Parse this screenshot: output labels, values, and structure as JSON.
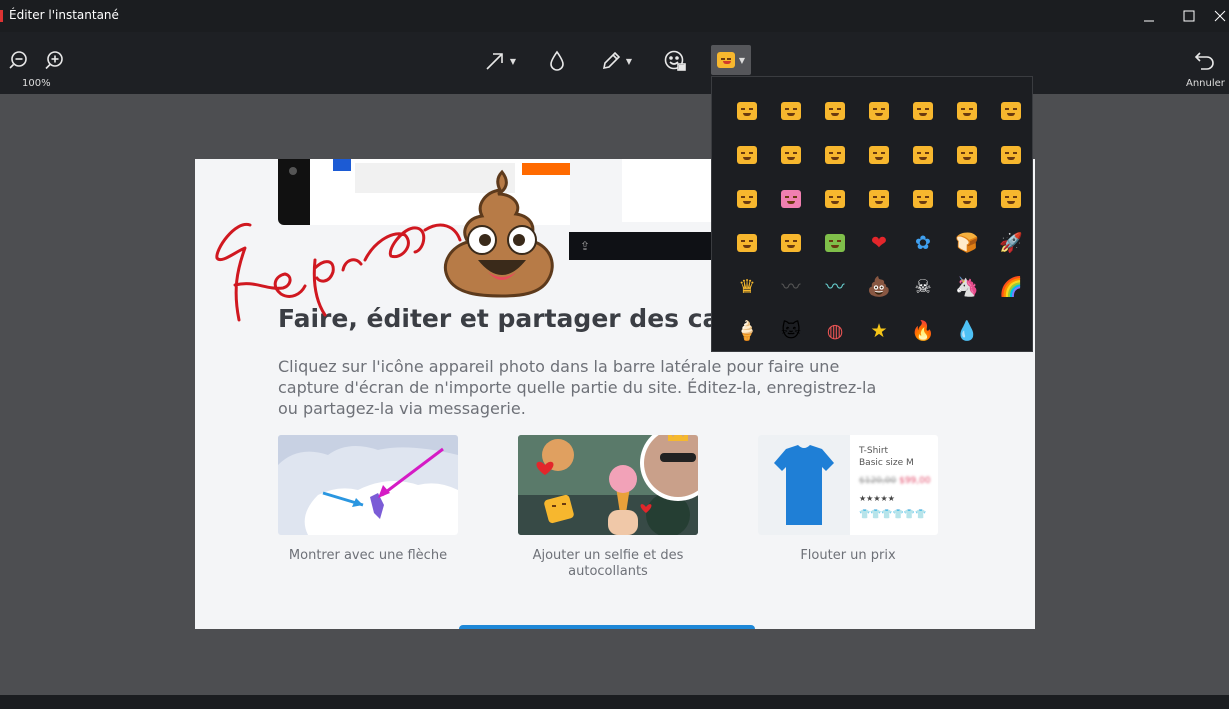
{
  "window": {
    "title": "Éditer l'instantané"
  },
  "toolbar": {
    "zoom_out": "zoom-out",
    "zoom_in": "zoom-in",
    "zoom_level": "100%",
    "undo_label": "Annuler"
  },
  "page": {
    "heading": "Faire, éditer et partager des capt",
    "description": "Cliquez sur l'icône appareil photo dans la barre latérale pour faire une capture d'écran de n'importe quelle partie du site. Éditez-la, enregistrez-la ou partagez-la via messagerie.",
    "cards": [
      {
        "label": "Montrer avec une flèche"
      },
      {
        "label": "Ajouter un selfie et des autocollants"
      },
      {
        "label": "Flouter un prix"
      }
    ],
    "product": {
      "name": "T-Shirt",
      "size": "Basic size M",
      "old_price": "$120,00",
      "new_price": "$99,00",
      "stars": "★★★★★"
    }
  },
  "stickers": {
    "items": [
      "face-1",
      "face-2",
      "face-3",
      "face-4",
      "face-5",
      "face-6",
      "face-heart-eyes",
      "face-halo",
      "face-tears",
      "face-kiss",
      "face-tongue",
      "face-smirk",
      "face-wink",
      "face-neutral",
      "face-mouth-open",
      "face-pink-cat",
      "face-grin",
      "face-laugh",
      "face-frown",
      "face-content",
      "face-sly",
      "face-rainbow",
      "face-glasses",
      "face-robot",
      "heart",
      "flower",
      "bread",
      "rocket",
      "crown",
      "mustache-dark",
      "mustache-teal",
      "poop",
      "skull",
      "unicorn",
      "rainbow",
      "ice-cream",
      "pink-cat-head",
      "beach-ball",
      "star",
      "fire",
      "droplet"
    ],
    "glyphs": {
      "heart": "❤",
      "flower": "✿",
      "bread": "🍞",
      "rocket": "🚀",
      "crown": "♛",
      "mustache-dark": "〰",
      "mustache-teal": "〰",
      "poop": "💩",
      "skull": "☠",
      "unicorn": "🦄",
      "rainbow": "🌈",
      "ice-cream": "🍦",
      "pink-cat-head": "🐱",
      "beach-ball": "◍",
      "star": "★",
      "fire": "🔥",
      "droplet": "💧"
    }
  },
  "colors": {
    "accent_blue": "#1e88d8",
    "sticker_yellow": "#f7b72e",
    "ink_red": "#d01820"
  }
}
